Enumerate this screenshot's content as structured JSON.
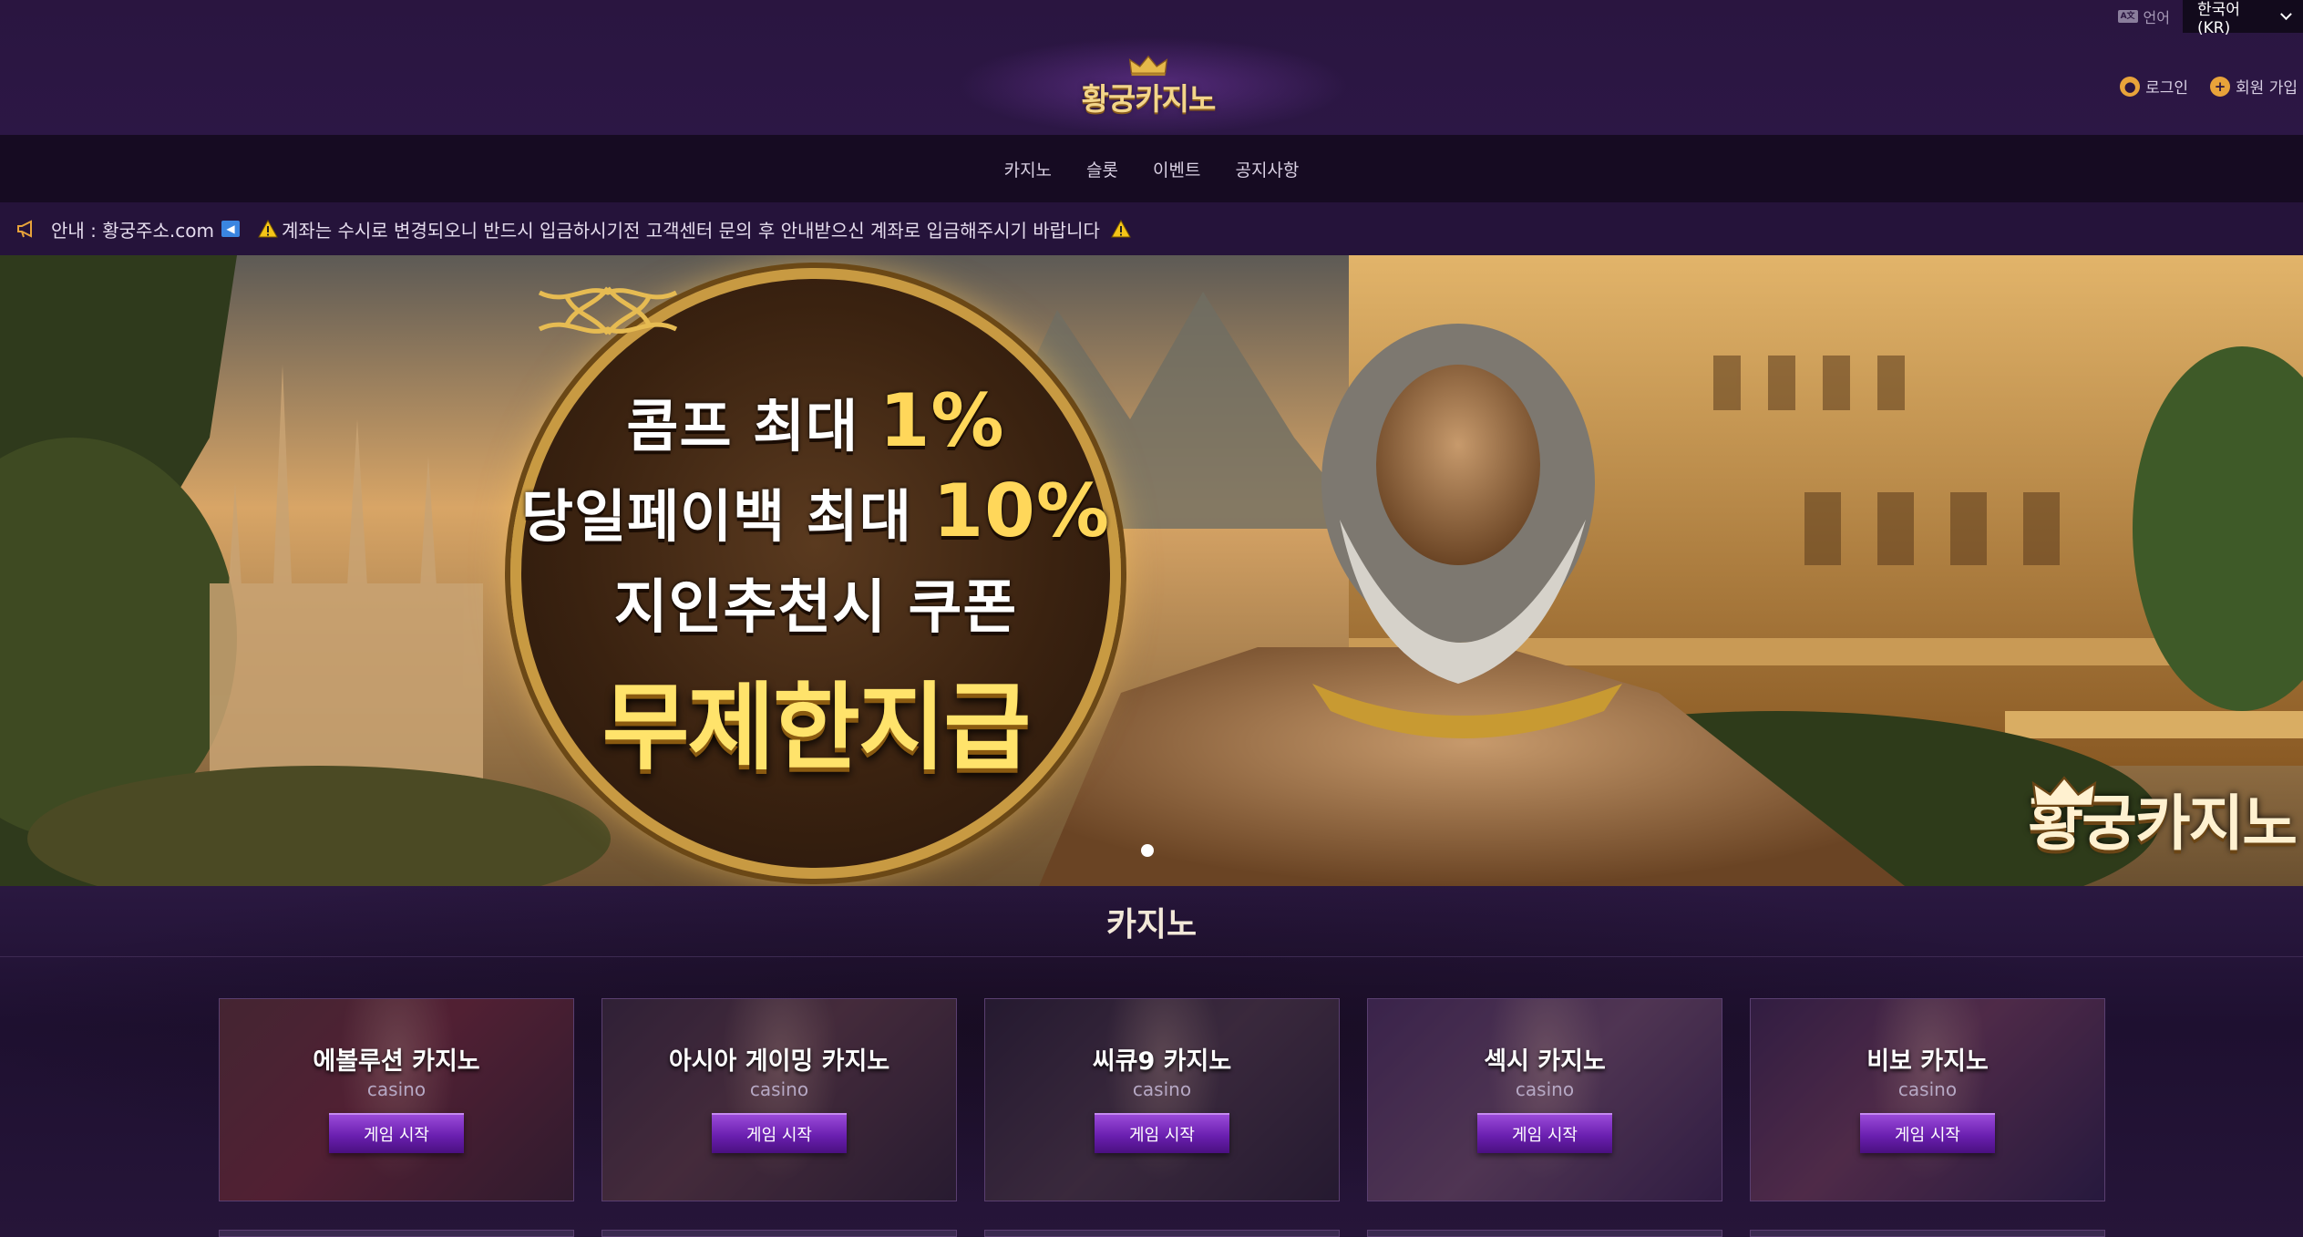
{
  "header": {
    "lang_label": "언어",
    "lang_selected": "한국어 (KR)",
    "logo_text": "황궁카지노",
    "login_label": "로그인",
    "signup_label": "회원 가입"
  },
  "nav": {
    "items": [
      {
        "label": "카지노"
      },
      {
        "label": "슬롯"
      },
      {
        "label": "이벤트"
      },
      {
        "label": "공지사항"
      }
    ]
  },
  "notice": {
    "domain_text": "안내 : 황궁주소.com",
    "message": "계좌는 수시로 변경되오니 반드시 입금하시기전 고객센터 문의 후 안내받으신 계좌로 입금해주시기 바랍니다"
  },
  "banner": {
    "line1_prefix": "콤프 최대",
    "line1_value": "1%",
    "line2_prefix": "당일페이백 최대",
    "line2_value": "10%",
    "line3": "지인추천시 쿠폰",
    "line4": "무제한지급",
    "logo_text": "황궁카지노"
  },
  "section": {
    "title": "카지노",
    "cards": [
      {
        "title": "에볼루션 카지노",
        "sub": "casino",
        "button": "게임 시작"
      },
      {
        "title": "아시아 게이밍 카지노",
        "sub": "casino",
        "button": "게임 시작"
      },
      {
        "title": "씨큐9 카지노",
        "sub": "casino",
        "button": "게임 시작"
      },
      {
        "title": "섹시 카지노",
        "sub": "casino",
        "button": "게임 시작"
      },
      {
        "title": "비보 카지노",
        "sub": "casino",
        "button": "게임 시작"
      }
    ]
  },
  "colors": {
    "header_bg": "#2a1540",
    "nav_bg": "#160b22",
    "accent_gold": "#f3d58a",
    "button_purple": "#6a1fb0"
  }
}
